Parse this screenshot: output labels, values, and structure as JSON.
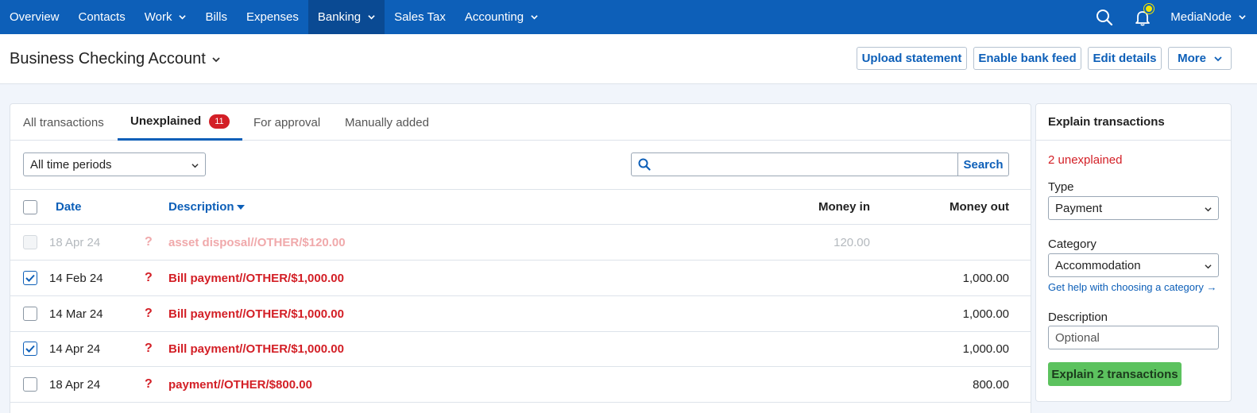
{
  "nav": {
    "items": [
      {
        "label": "Overview"
      },
      {
        "label": "Contacts"
      },
      {
        "label": "Work"
      },
      {
        "label": "Bills"
      },
      {
        "label": "Expenses"
      },
      {
        "label": "Banking"
      },
      {
        "label": "Sales Tax"
      },
      {
        "label": "Accounting"
      }
    ],
    "active": "Banking",
    "user": "MediaNode"
  },
  "header": {
    "account_title": "Business Checking Account",
    "buttons": {
      "upload": "Upload statement",
      "bank_feed": "Enable bank feed",
      "edit": "Edit details",
      "more": "More"
    }
  },
  "tabs": [
    {
      "label": "All transactions"
    },
    {
      "label": "Unexplained",
      "badge": "11"
    },
    {
      "label": "For approval"
    },
    {
      "label": "Manually added"
    }
  ],
  "active_tab": "Unexplained",
  "filter": {
    "period": "All time periods"
  },
  "search": {
    "placeholder": "",
    "button": "Search"
  },
  "table": {
    "columns": {
      "date": "Date",
      "description": "Description",
      "money_in": "Money in",
      "money_out": "Money out"
    },
    "rows": [
      {
        "checked": false,
        "disabled": true,
        "date": "18 Apr 24",
        "flag": "?",
        "description": "asset disposal//OTHER/$120.00",
        "money_in": "120.00",
        "money_out": ""
      },
      {
        "checked": true,
        "disabled": false,
        "date": "14 Feb 24",
        "flag": "?",
        "description": "Bill payment//OTHER/$1,000.00",
        "money_in": "",
        "money_out": "1,000.00"
      },
      {
        "checked": false,
        "disabled": false,
        "date": "14 Mar 24",
        "flag": "?",
        "description": "Bill payment//OTHER/$1,000.00",
        "money_in": "",
        "money_out": "1,000.00"
      },
      {
        "checked": true,
        "disabled": false,
        "date": "14 Apr 24",
        "flag": "?",
        "description": "Bill payment//OTHER/$1,000.00",
        "money_in": "",
        "money_out": "1,000.00"
      },
      {
        "checked": false,
        "disabled": false,
        "date": "18 Apr 24",
        "flag": "?",
        "description": "payment//OTHER/$800.00",
        "money_in": "",
        "money_out": "800.00"
      }
    ]
  },
  "explain": {
    "title": "Explain transactions",
    "unexplained_text": "2 unexplained",
    "type_label": "Type",
    "type_value": "Payment",
    "category_label": "Category",
    "category_value": "Accommodation",
    "help_link": "Get help with choosing a category →",
    "description_label": "Description",
    "description_placeholder": "Optional",
    "submit": "Explain 2 transactions"
  },
  "colors": {
    "nav_bg": "#0d5fb8",
    "nav_active": "#0a4a93",
    "link": "#0d5fb8",
    "unexplained_red": "#d31f26",
    "explain_green": "#5cc25e",
    "bell_dot": "#f3e600"
  },
  "icons": {
    "search": "search-icon",
    "bell": "bell-icon",
    "chevron": "chevron-down-icon",
    "sort": "sort-desc-icon",
    "check": "check-icon"
  }
}
